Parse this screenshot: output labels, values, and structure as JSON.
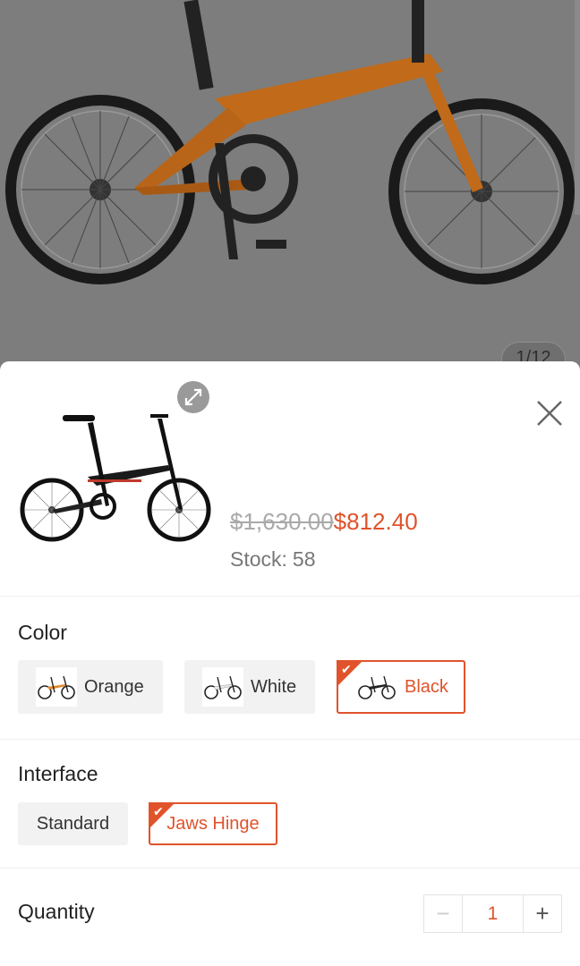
{
  "product_gallery": {
    "counter": "1/12"
  },
  "sheet": {
    "original_price": "$1,630.00",
    "sale_price": "$812.40",
    "stock_label": "Stock:",
    "stock_value": "58"
  },
  "color": {
    "label": "Color",
    "options": [
      {
        "label": "Orange",
        "selected": false
      },
      {
        "label": "White",
        "selected": false
      },
      {
        "label": "Black",
        "selected": true
      }
    ]
  },
  "interface": {
    "label": "Interface",
    "options": [
      {
        "label": "Standard",
        "selected": false
      },
      {
        "label": "Jaws Hinge",
        "selected": true
      }
    ]
  },
  "quantity": {
    "label": "Quantity",
    "value": "1",
    "minus": "−",
    "plus": "+"
  },
  "colors": {
    "accent": "#e0532b",
    "chip_bg": "#f2f2f2",
    "overlay": "#7d7d7d"
  },
  "icons": {
    "expand": "expand-icon",
    "close": "close-icon",
    "check": "check-icon"
  }
}
